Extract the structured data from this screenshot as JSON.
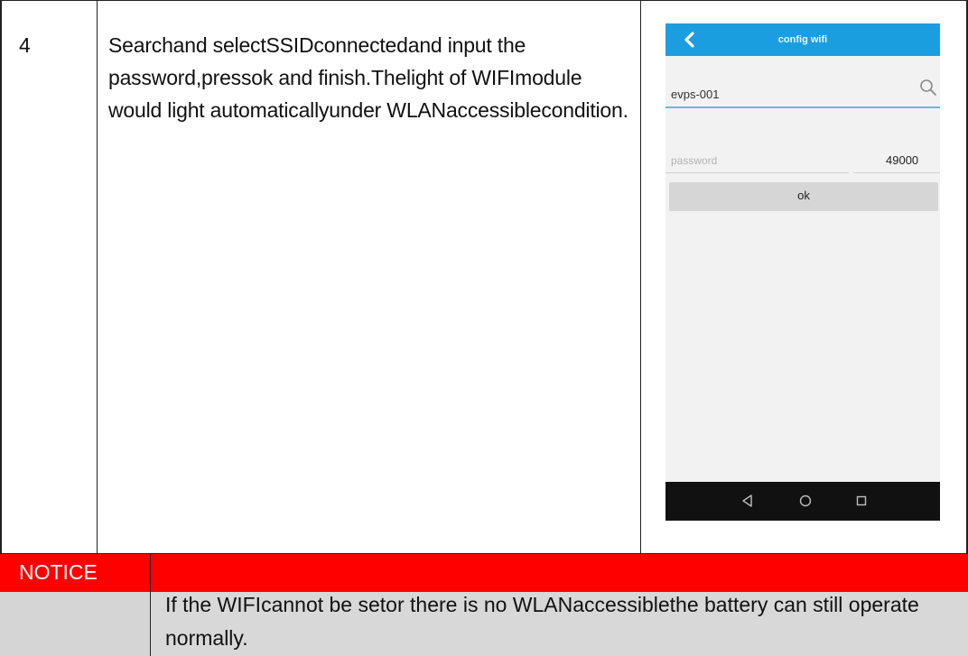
{
  "step": {
    "number": "4",
    "instruction": "Searchand selectSSIDconnectedand input the password,pressok and finish.Thelight of WIFImodule would light automaticallyunder WLANaccessiblecondition."
  },
  "phone": {
    "title": "config wifi",
    "ssid_value": "evps-001",
    "password_placeholder": "password",
    "port_value": "49000",
    "ok_label": "ok",
    "bar_color": "#1a9ee0",
    "icons": [
      "back-icon",
      "search-icon",
      "nav-back-icon",
      "nav-home-icon",
      "nav-recent-icon"
    ]
  },
  "notice": {
    "label": "NOTICE",
    "text": "If the WIFIcannot be setor there is no WLANaccessiblethe battery can still operate normally.",
    "bar_color": "#fe0000"
  }
}
